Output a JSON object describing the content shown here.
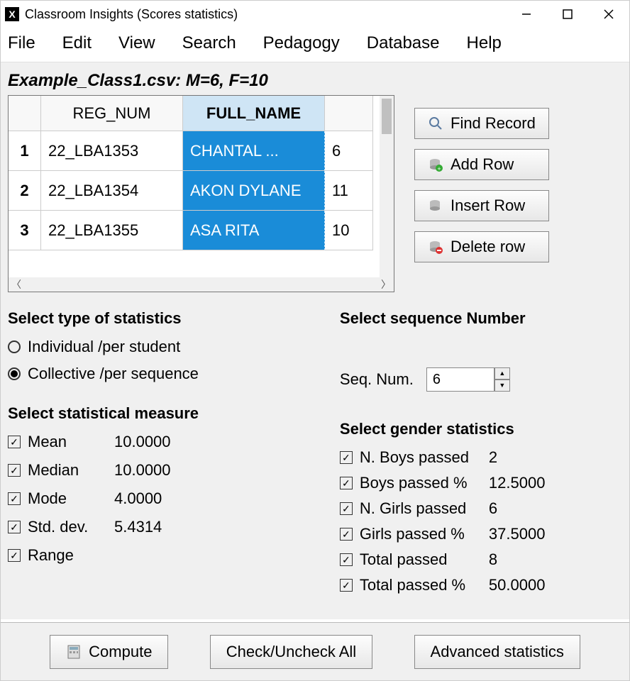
{
  "window": {
    "title": "Classroom Insights (Scores statistics)"
  },
  "menu": [
    "File",
    "Edit",
    "View",
    "Search",
    "Pedagogy",
    "Database",
    "Help"
  ],
  "file_summary": "Example_Class1.csv: M=6, F=10",
  "table": {
    "headers": [
      "",
      "REG_NUM",
      "FULL_NAME",
      ""
    ],
    "rows": [
      {
        "n": "1",
        "reg": "22_LBA1353",
        "name": "CHANTAL ...",
        "score": "6"
      },
      {
        "n": "2",
        "reg": "22_LBA1354",
        "name": "AKON DYLANE",
        "score": "11"
      },
      {
        "n": "3",
        "reg": "22_LBA1355",
        "name": "ASA RITA",
        "score": "10"
      }
    ]
  },
  "side_buttons": {
    "find": "Find Record",
    "add": "Add Row",
    "insert": "Insert Row",
    "delete": "Delete row"
  },
  "stats_type": {
    "title": "Select type of statistics",
    "opt1": "Individual /per student",
    "opt2": "Collective /per sequence",
    "selected": "opt2"
  },
  "sequence": {
    "title": "Select sequence Number",
    "label": "Seq. Num.",
    "value": "6"
  },
  "measures": {
    "title": "Select statistical measure",
    "items": [
      {
        "label": "Mean",
        "value": "10.0000",
        "checked": true
      },
      {
        "label": "Median",
        "value": "10.0000",
        "checked": true
      },
      {
        "label": "Mode",
        "value": "4.0000",
        "checked": true
      },
      {
        "label": "Std. dev.",
        "value": "5.4314",
        "checked": true
      },
      {
        "label": "Range",
        "value": "",
        "checked": true
      }
    ]
  },
  "gender": {
    "title": "Select gender statistics",
    "items": [
      {
        "label": "N. Boys passed",
        "value": "2",
        "checked": true
      },
      {
        "label": "Boys passed %",
        "value": "12.5000",
        "checked": true
      },
      {
        "label": "N. Girls passed",
        "value": "6",
        "checked": true
      },
      {
        "label": "Girls passed %",
        "value": "37.5000",
        "checked": true
      },
      {
        "label": "Total passed",
        "value": "8",
        "checked": true
      },
      {
        "label": "Total passed %",
        "value": "50.0000",
        "checked": true
      }
    ]
  },
  "bottom": {
    "compute": "Compute",
    "checkall": "Check/Uncheck All",
    "advanced": "Advanced statistics"
  }
}
